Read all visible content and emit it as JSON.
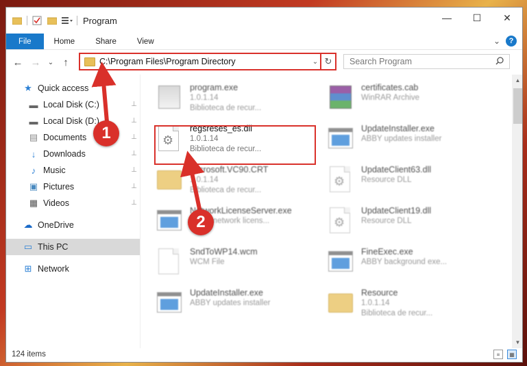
{
  "window": {
    "title": "Program",
    "controls": {
      "minimize": "—",
      "maximize": "☐",
      "close": "✕"
    }
  },
  "ribbon": {
    "tabs": [
      "File",
      "Home",
      "Share",
      "View"
    ],
    "expand_glyph": "⌄",
    "help_glyph": "?"
  },
  "address": {
    "path": "C:\\Program Files\\Program Directory",
    "dropdown_glyph": "⌄",
    "refresh_glyph": "↻"
  },
  "search": {
    "placeholder": "Search Program"
  },
  "nav": {
    "back": "←",
    "forward": "→",
    "recent": "⌄",
    "up": "↑",
    "items": [
      {
        "label": "Quick access",
        "icon": "star-icon",
        "glyph": "★"
      },
      {
        "label": "Local Disk (C:)",
        "icon": "drive-icon",
        "glyph": "▬"
      },
      {
        "label": "Local Disk (D:)",
        "icon": "drive-icon",
        "glyph": "▬"
      },
      {
        "label": "Documents",
        "icon": "documents-icon",
        "glyph": "▤"
      },
      {
        "label": "Downloads",
        "icon": "download-arrow-icon",
        "glyph": "↓"
      },
      {
        "label": "Music",
        "icon": "music-note-icon",
        "glyph": "♪"
      },
      {
        "label": "Pictures",
        "icon": "pictures-icon",
        "glyph": "▣"
      },
      {
        "label": "Videos",
        "icon": "film-icon",
        "glyph": "▦"
      },
      {
        "label": "OneDrive",
        "icon": "cloud-icon",
        "glyph": "☁"
      },
      {
        "label": "This PC",
        "icon": "monitor-icon",
        "glyph": "▭"
      },
      {
        "label": "Network",
        "icon": "network-icon",
        "glyph": "⊞"
      }
    ],
    "pin_glyph": "📌"
  },
  "files": [
    {
      "name": "program.exe",
      "meta1": "1.0.1.14",
      "meta2": "Biblioteca de recur...",
      "kind": "exe"
    },
    {
      "name": "certificates.cab",
      "meta1": "WinRAR Archive",
      "meta2": "",
      "kind": "rar"
    },
    {
      "name": "regsreses_es.dll",
      "meta1": "1.0.1.14",
      "meta2": "Biblioteca de recur...",
      "kind": "dll"
    },
    {
      "name": "UpdateInstaller.exe",
      "meta1": "ABBY updates installer",
      "meta2": "",
      "kind": "app"
    },
    {
      "name": "Microsoft.VC90.CRT",
      "meta1": "1.0.1.14",
      "meta2": "Biblioteca de recur...",
      "kind": "folder"
    },
    {
      "name": "UpdateClient63.dll",
      "meta1": "Resource DLL",
      "meta2": "",
      "kind": "dll"
    },
    {
      "name": "NetworkLicenseServer.exe",
      "meta1": "ABBY network licens...",
      "meta2": "",
      "kind": "app"
    },
    {
      "name": "UpdateClient19.dll",
      "meta1": "Resource DLL",
      "meta2": "",
      "kind": "dll"
    },
    {
      "name": "SndToWP14.wcm",
      "meta1": "WCM File",
      "meta2": "",
      "kind": "doc"
    },
    {
      "name": "FineExec.exe",
      "meta1": "ABBY background exe...",
      "meta2": "",
      "kind": "app"
    },
    {
      "name": "UpdateInstaller.exe",
      "meta1": "ABBY updates installer",
      "meta2": "",
      "kind": "app"
    },
    {
      "name": "Resource",
      "meta1": "1.0.1.14",
      "meta2": "Biblioteca de recur...",
      "kind": "folder"
    }
  ],
  "status": {
    "items_count": "124 items"
  },
  "annotations": {
    "badge1": "1",
    "badge2": "2",
    "accent": "#d9302a"
  }
}
